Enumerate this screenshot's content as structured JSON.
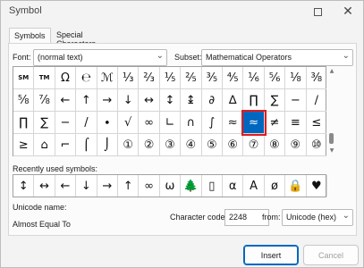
{
  "window": {
    "title": "Symbol"
  },
  "tabs": [
    {
      "label": "Symbols",
      "active": true
    },
    {
      "label": "Special Characters",
      "active": false
    }
  ],
  "font": {
    "label": "Font:",
    "value": "(normal text)"
  },
  "subset": {
    "label": "Subset:",
    "value": "Mathematical Operators"
  },
  "symbol_grid": {
    "rows": [
      [
        "SM",
        "TM",
        "Ω",
        "℮",
        "ℳ",
        "⅓",
        "⅔",
        "⅕",
        "⅖",
        "⅗",
        "⅘",
        "⅙",
        "⅚",
        "⅛",
        "⅜"
      ],
      [
        "⅝",
        "⅞",
        "←",
        "↑",
        "→",
        "↓",
        "↔",
        "↕",
        "↨",
        "∂",
        "∆",
        "∏",
        "∑",
        "−",
        "∕"
      ],
      [
        "∏",
        "∑",
        "−",
        "/",
        "∙",
        "√",
        "∞",
        "∟",
        "∩",
        "∫",
        "≈",
        "≈",
        "≠",
        "≡",
        "≤"
      ],
      [
        "≥",
        "⌂",
        "⌐",
        "⌠",
        "⌡",
        "①",
        "②",
        "③",
        "④",
        "⑤",
        "⑥",
        "⑦",
        "⑧",
        "⑨",
        "⑩"
      ]
    ],
    "selected_symbol": "≈",
    "selected_color": "#0067c0",
    "highlight_color": "#e01c1c"
  },
  "recent": {
    "label": "Recently used symbols:",
    "symbols": [
      "↕",
      "↔",
      "←",
      "↓",
      "→",
      "↑",
      "∞",
      "ω",
      "🌲",
      "▯",
      "α",
      "A",
      "ø",
      "🔒",
      "♥"
    ]
  },
  "unicode": {
    "name_label": "Unicode name:",
    "name_value": "Almost Equal To",
    "code_label": "Character code:",
    "code_value": "2248",
    "from_label": "from:",
    "from_value": "Unicode (hex)"
  },
  "buttons": {
    "insert": "Insert",
    "cancel": "Cancel"
  }
}
